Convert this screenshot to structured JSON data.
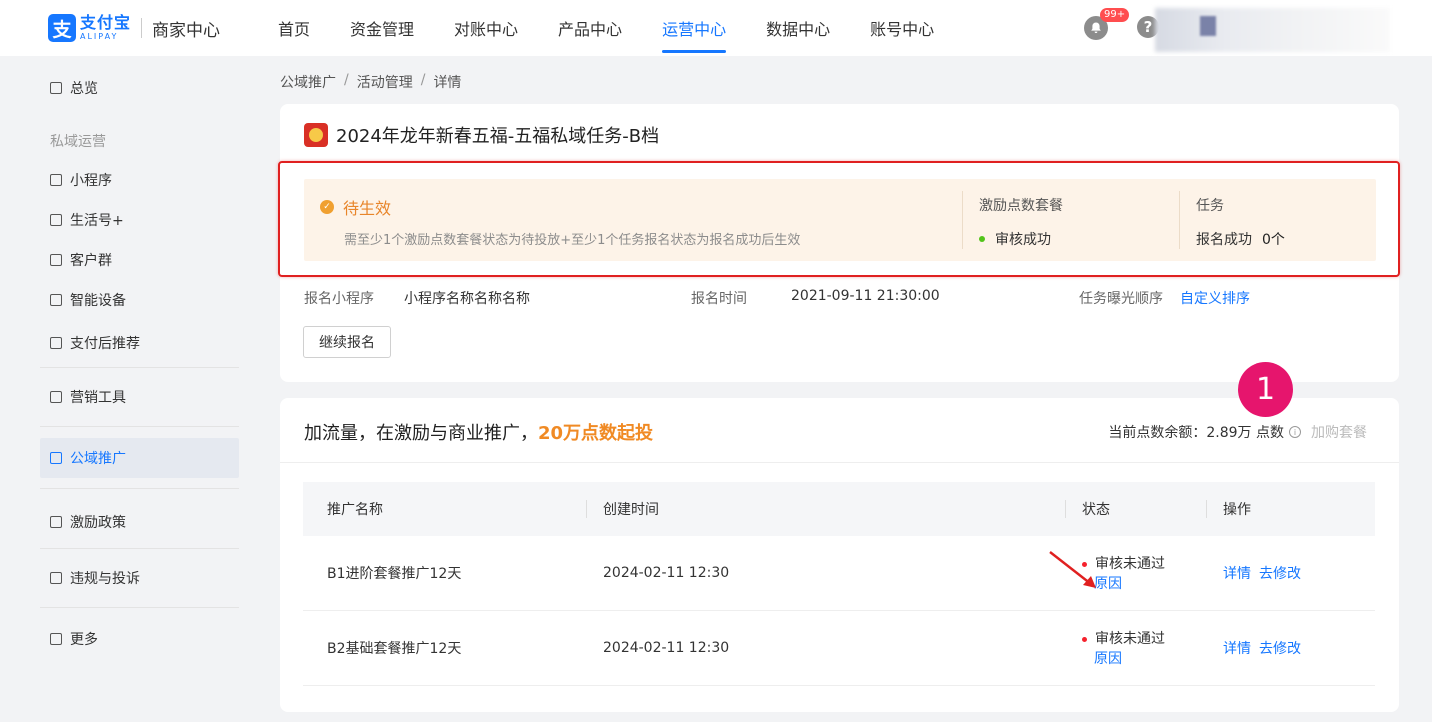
{
  "header": {
    "logo_cn": "支付宝",
    "logo_en": "ALIPAY",
    "logo_sub": "商家中心",
    "nav": [
      "首页",
      "资金管理",
      "对账中心",
      "产品中心",
      "运营中心",
      "数据中心",
      "账号中心"
    ],
    "active_nav": "运营中心",
    "notifications_badge": "99+",
    "help_glyph": "?"
  },
  "sidebar": {
    "overview": "总览",
    "group_private": "私域运营",
    "mini_program": "小程序",
    "life_account": "生活号+",
    "customer_group": "客户群",
    "smart_device": "智能设备",
    "post_pay": "支付后推荐",
    "marketing_tools": "营销工具",
    "public_promo": "公域推广",
    "incentive_policy": "激励政策",
    "violation": "违规与投诉",
    "more": "更多"
  },
  "breadcrumb": [
    "公域推广",
    "活动管理",
    "详情"
  ],
  "breadcrumb_sep": "/",
  "activity": {
    "title": "2024年龙年新春五福-五福私域任务-B档",
    "status": {
      "label": "待生效",
      "desc": "需至少1个激励点数套餐状态为待投放+至少1个任务报名状态为报名成功后生效",
      "package_label": "激励点数套餐",
      "package_value": "审核成功",
      "task_label": "任务",
      "task_value_label": "报名成功",
      "task_value_count": "0个"
    },
    "info": {
      "mini_program_label": "报名小程序",
      "mini_program_value": "小程序名称名称名称",
      "signup_time_label": "报名时间",
      "signup_time_value": "2021-09-11 21:30:00",
      "exposure_label": "任务曝光顺序",
      "exposure_link": "自定义排序"
    },
    "continue_btn": "继续报名"
  },
  "promo": {
    "title_prefix": "加流量，在激励与商业推广，",
    "title_highlight": "20万点数起投",
    "balance_label": "当前点数余额：",
    "balance_value": "2.89万 点数",
    "info_glyph": "i",
    "buy_label": "加购套餐",
    "marker": "1",
    "table": {
      "headers": [
        "推广名称",
        "创建时间",
        "状态",
        "操作"
      ],
      "rows": [
        {
          "name": "B1进阶套餐推广12天",
          "created": "2024-02-11 12:30",
          "status": "审核未通过",
          "reason": "原因",
          "op_detail": "详情",
          "op_edit": "去修改"
        },
        {
          "name": "B2基础套餐推广12天",
          "created": "2024-02-11 12:30",
          "status": "审核未通过",
          "reason": "原因",
          "op_detail": "详情",
          "op_edit": "去修改"
        }
      ]
    }
  },
  "colors": {
    "brand": "#1677ff",
    "pending": "#e8852a",
    "highlight_box": "#e02020",
    "marker": "#e6156d",
    "status_rejected": "#f5222d",
    "status_ok": "#52c41a"
  }
}
